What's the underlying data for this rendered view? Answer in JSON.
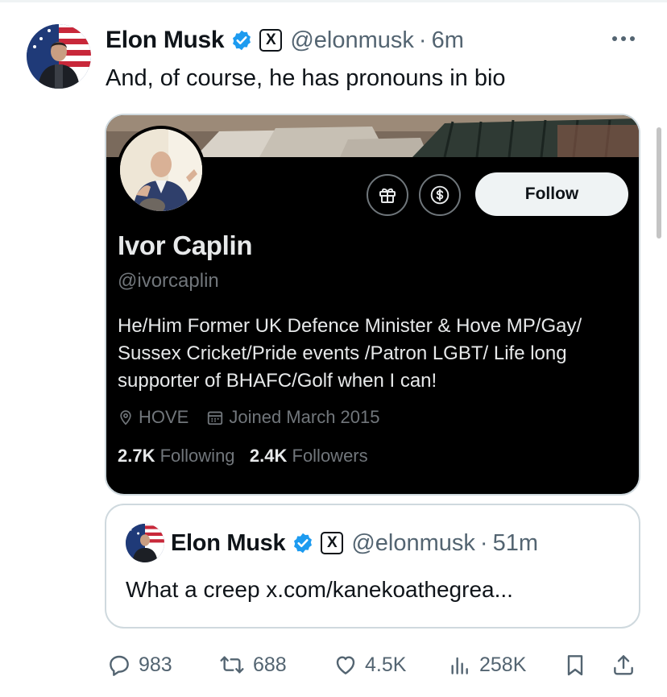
{
  "tweet": {
    "author_name": "Elon Musk",
    "author_handle": "@elonmusk",
    "separator": "·",
    "time": "6m",
    "badge_x": "X",
    "text": "And, of course, he has pronouns in bio",
    "more_icon": "more-horizontal-icon"
  },
  "profile_card": {
    "name": "Ivor Caplin",
    "handle": "@ivorcaplin",
    "follow_label": "Follow",
    "bio": "He/Him Former UK Defence Minister & Hove MP/Gay/ Sussex Cricket/Pride events /Patron LGBT/ Life long supporter of BHAFC/Golf when I can!",
    "location": "HOVE",
    "joined": "Joined March 2015",
    "following_count": "2.7K",
    "following_label": "Following",
    "followers_count": "2.4K",
    "followers_label": "Followers",
    "gift_icon": "gift-icon",
    "tip_icon": "dollar-icon"
  },
  "quoted_tweet": {
    "author_name": "Elon Musk",
    "author_handle": "@elonmusk",
    "separator": "·",
    "time": "51m",
    "badge_x": "X",
    "text": "What a creep x.com/kanekoathegrea..."
  },
  "actions": {
    "replies": "983",
    "reposts": "688",
    "likes": "4.5K",
    "views": "258K"
  },
  "colors": {
    "verified_blue": "#1d9bf0",
    "secondary_text": "#536471",
    "card_background": "#000000"
  }
}
